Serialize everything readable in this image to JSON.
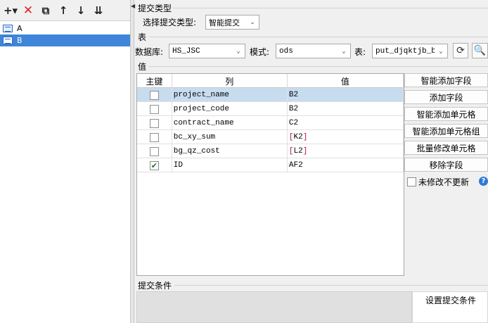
{
  "toolbar": {
    "icons": [
      "plus-dropdown-icon",
      "delete-icon",
      "copy-icon",
      "move-up-icon",
      "move-down-icon",
      "move-bottom-icon"
    ],
    "add_glyph": "+▾",
    "delete_glyph": "✕",
    "copy_glyph": "⧉",
    "up_glyph": "↑",
    "down_glyph": "↓",
    "bottom_glyph": "⇊"
  },
  "tree": {
    "items": [
      {
        "label": "A",
        "selected": false
      },
      {
        "label": "B",
        "selected": true
      }
    ]
  },
  "submit_type": {
    "section_label": "提交类型",
    "select_label": "选择提交类型:",
    "selected_value": "智能提交"
  },
  "table_section": {
    "section_label": "表",
    "db_label": "数据库:",
    "db_value": "HS_JSC",
    "schema_label": "模式:",
    "schema_value": "ods",
    "table_label": "表:",
    "table_value": "put_djqktjb_b"
  },
  "values_section": {
    "section_label": "值",
    "columns": [
      "主键",
      "列",
      "值"
    ],
    "rows": [
      {
        "key": false,
        "column": "project_name",
        "value": "B2",
        "selected": true
      },
      {
        "key": false,
        "column": "project_code",
        "value": "B2",
        "selected": false
      },
      {
        "key": false,
        "column": "contract_name",
        "value": "C2",
        "selected": false
      },
      {
        "key": false,
        "column": "bc_xy_sum",
        "value_open": "[",
        "value_inner": "K2",
        "value_close": "]",
        "selected": false
      },
      {
        "key": false,
        "column": "bg_qz_cost",
        "value_open": "[",
        "value_inner": "L2",
        "value_close": "]",
        "selected": false
      },
      {
        "key": true,
        "column": "ID",
        "value": "AF2",
        "selected": false
      }
    ],
    "check_glyph": "✔"
  },
  "side_buttons": {
    "smart_add_field": "智能添加字段",
    "add_field": "添加字段",
    "smart_add_cell": "智能添加单元格",
    "smart_add_cell_group": "智能添加单元格组",
    "batch_edit_cell": "批量修改单元格",
    "remove_field": "移除字段",
    "no_update_label": "未修改不更新",
    "help_glyph": "?"
  },
  "condition": {
    "section_label": "提交条件",
    "set_button": "设置提交条件"
  }
}
